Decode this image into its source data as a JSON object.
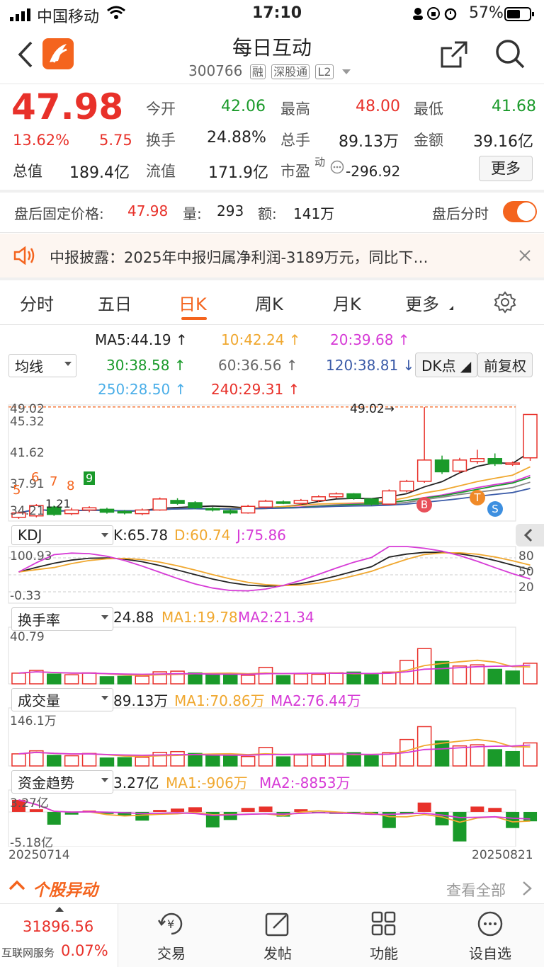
{
  "status_bar": {
    "carrier": "中国移动",
    "time": "17:10",
    "battery": "57%"
  },
  "header": {
    "title": "每日互动",
    "code": "300766",
    "badges": [
      "融",
      "深股通",
      "L2"
    ]
  },
  "quote": {
    "price": "47.98",
    "change_pct": "13.62%",
    "change": "5.75",
    "total_cap_label": "总值",
    "total_cap": "189.4亿",
    "open_label": "今开",
    "open": "42.06",
    "high_label": "最高",
    "high": "48.00",
    "low_label": "最低",
    "low": "41.68",
    "turnover_label": "换手",
    "turnover": "24.88%",
    "volume_label": "总手",
    "volume": "89.13万",
    "amount_label": "金额",
    "amount": "39.16亿",
    "float_label": "流值",
    "float_cap": "171.9亿",
    "pe_label": "市盈",
    "pe_sup": "动",
    "pe": "-296.92",
    "more": "更多"
  },
  "after_hours": {
    "price_label": "盘后固定价格:",
    "price": "47.98",
    "vol_label": "量:",
    "vol": "293",
    "amt_label": "额:",
    "amt": "141万",
    "toggle_label": "盘后分时"
  },
  "notice": {
    "text": "中报披露：2025年中报归属净利润-3189万元，同比下…"
  },
  "tabs": [
    "分时",
    "五日",
    "日K",
    "周K",
    "月K",
    "更多"
  ],
  "ma": {
    "ma5": "MA5:44.19",
    "ma10": "10:42.24",
    "ma20": "20:39.68",
    "ma30": "30:38.58",
    "ma60": "60:36.56",
    "ma120": "120:38.81",
    "ma250": "250:28.50",
    "ma240": "240:29.31",
    "selector": "均线",
    "dk": "DK点",
    "adj": "前复权"
  },
  "kline": {
    "y_top": "49.02",
    "y2": "45.32",
    "y3": "41.62",
    "y4": "37.91",
    "y5": "34.21",
    "max_label": "49.02",
    "seq_labels": [
      "5",
      "6",
      "7",
      "8",
      "9"
    ],
    "markers": [
      "B",
      "T",
      "S"
    ],
    "bar_partial": "1.21"
  },
  "kdj": {
    "selector": "KDJ",
    "k": "K:65.78",
    "d": "D:60.74",
    "j": "J:75.86",
    "top": "100.93",
    "bottom": "-0.33",
    "r80": "80",
    "r50": "50",
    "r20": "20"
  },
  "turnover_panel": {
    "selector": "换手率",
    "value": "24.88",
    "ma1": "MA1:19.78",
    "ma2": "MA2:21.34",
    "max": "40.79"
  },
  "volume_panel": {
    "selector": "成交量",
    "value": "89.13万",
    "ma1": "MA1:70.86万",
    "ma2": "MA2:76.44万",
    "max": "146.1万"
  },
  "fund_panel": {
    "selector": "资金趋势",
    "value": "3.27亿",
    "ma1": "MA1:-906万",
    "ma2": "MA2:-8853万",
    "max": "3.27亿",
    "min": "-5.18亿"
  },
  "dates": {
    "start": "20250714",
    "end": "20250821"
  },
  "movers": {
    "title": "个股异动",
    "view_all": "查看全部"
  },
  "bottom_bar": {
    "index_value": "31896.56",
    "index_label": "互联网服务",
    "index_pct": "0.07%",
    "trade": "交易",
    "post": "发帖",
    "func": "功能",
    "watch": "设自选"
  },
  "colors": {
    "red": "#e8312a",
    "green": "#1a9a2a",
    "accent": "#f4641e"
  },
  "chart_data": {
    "type": "candlestick",
    "candles": [
      {
        "o": 34.0,
        "c": 34.6,
        "h": 34.9,
        "l": 33.8
      },
      {
        "o": 34.2,
        "c": 35.6,
        "h": 35.8,
        "l": 34.0
      },
      {
        "o": 35.4,
        "c": 34.4,
        "h": 35.6,
        "l": 34.2
      },
      {
        "o": 34.5,
        "c": 35.0,
        "h": 35.3,
        "l": 34.3
      },
      {
        "o": 35.0,
        "c": 35.3,
        "h": 35.5,
        "l": 34.7
      },
      {
        "o": 35.1,
        "c": 34.7,
        "h": 35.3,
        "l": 34.5
      },
      {
        "o": 34.8,
        "c": 34.6,
        "h": 35.0,
        "l": 34.4
      },
      {
        "o": 34.5,
        "c": 35.0,
        "h": 35.2,
        "l": 34.3
      },
      {
        "o": 35.0,
        "c": 36.5,
        "h": 36.7,
        "l": 34.9
      },
      {
        "o": 36.3,
        "c": 35.9,
        "h": 36.6,
        "l": 35.7
      },
      {
        "o": 36.0,
        "c": 35.3,
        "h": 36.2,
        "l": 35.1
      },
      {
        "o": 35.2,
        "c": 35.0,
        "h": 35.4,
        "l": 34.8
      },
      {
        "o": 34.9,
        "c": 34.6,
        "h": 35.1,
        "l": 34.4
      },
      {
        "o": 34.6,
        "c": 35.5,
        "h": 35.7,
        "l": 34.5
      },
      {
        "o": 35.4,
        "c": 36.2,
        "h": 36.4,
        "l": 35.2
      },
      {
        "o": 36.1,
        "c": 36.0,
        "h": 36.3,
        "l": 35.8
      },
      {
        "o": 35.9,
        "c": 36.3,
        "h": 36.5,
        "l": 35.7
      },
      {
        "o": 36.3,
        "c": 36.8,
        "h": 37.0,
        "l": 36.1
      },
      {
        "o": 36.8,
        "c": 37.2,
        "h": 37.4,
        "l": 36.6
      },
      {
        "o": 37.2,
        "c": 36.6,
        "h": 37.3,
        "l": 36.4
      },
      {
        "o": 36.5,
        "c": 35.8,
        "h": 36.6,
        "l": 35.6
      },
      {
        "o": 35.8,
        "c": 37.6,
        "h": 37.8,
        "l": 35.7
      },
      {
        "o": 37.6,
        "c": 38.9,
        "h": 39.1,
        "l": 37.4
      },
      {
        "o": 38.9,
        "c": 41.8,
        "h": 49.0,
        "l": 38.7
      },
      {
        "o": 41.8,
        "c": 40.2,
        "h": 42.4,
        "l": 39.9
      },
      {
        "o": 40.3,
        "c": 41.8,
        "h": 42.1,
        "l": 40.0
      },
      {
        "o": 41.6,
        "c": 42.0,
        "h": 43.2,
        "l": 41.3
      },
      {
        "o": 42.0,
        "c": 41.3,
        "h": 42.7,
        "l": 41.0
      },
      {
        "o": 41.3,
        "c": 41.4,
        "h": 41.6,
        "l": 41.0
      },
      {
        "o": 42.1,
        "c": 48.0,
        "h": 48.0,
        "l": 41.7
      }
    ],
    "turnover": [
      {
        "v": 8.1,
        "up": true
      },
      {
        "v": 10.2,
        "up": true
      },
      {
        "v": 7.4,
        "up": false
      },
      {
        "v": 6.9,
        "up": true
      },
      {
        "v": 8.3,
        "up": true
      },
      {
        "v": 5.4,
        "up": false
      },
      {
        "v": 5.7,
        "up": false
      },
      {
        "v": 5.9,
        "up": true
      },
      {
        "v": 9.1,
        "up": true
      },
      {
        "v": 9.6,
        "up": true
      },
      {
        "v": 8.3,
        "up": false
      },
      {
        "v": 7.1,
        "up": false
      },
      {
        "v": 6.7,
        "up": false
      },
      {
        "v": 6.5,
        "up": true
      },
      {
        "v": 12.5,
        "up": true
      },
      {
        "v": 6.2,
        "up": false
      },
      {
        "v": 7.5,
        "up": true
      },
      {
        "v": 7.3,
        "up": true
      },
      {
        "v": 8.4,
        "up": true
      },
      {
        "v": 8.9,
        "up": false
      },
      {
        "v": 7.0,
        "up": false
      },
      {
        "v": 8.9,
        "up": true
      },
      {
        "v": 17.8,
        "up": true
      },
      {
        "v": 26.7,
        "up": true
      },
      {
        "v": 16.9,
        "up": false
      },
      {
        "v": 13.5,
        "up": true
      },
      {
        "v": 14.4,
        "up": true
      },
      {
        "v": 11.0,
        "up": false
      },
      {
        "v": 9.7,
        "up": false
      },
      {
        "v": 15.6,
        "up": true
      }
    ],
    "volume": [
      {
        "v": 32,
        "up": true
      },
      {
        "v": 40,
        "up": true
      },
      {
        "v": 28,
        "up": false
      },
      {
        "v": 27,
        "up": true
      },
      {
        "v": 33,
        "up": true
      },
      {
        "v": 21,
        "up": false
      },
      {
        "v": 22,
        "up": false
      },
      {
        "v": 23,
        "up": true
      },
      {
        "v": 36,
        "up": true
      },
      {
        "v": 38,
        "up": true
      },
      {
        "v": 33,
        "up": false
      },
      {
        "v": 28,
        "up": false
      },
      {
        "v": 26,
        "up": false
      },
      {
        "v": 25,
        "up": true
      },
      {
        "v": 49,
        "up": true
      },
      {
        "v": 24,
        "up": false
      },
      {
        "v": 29,
        "up": true
      },
      {
        "v": 28,
        "up": true
      },
      {
        "v": 33,
        "up": true
      },
      {
        "v": 35,
        "up": false
      },
      {
        "v": 27,
        "up": false
      },
      {
        "v": 35,
        "up": true
      },
      {
        "v": 70,
        "up": true
      },
      {
        "v": 104,
        "up": true
      },
      {
        "v": 66,
        "up": false
      },
      {
        "v": 53,
        "up": true
      },
      {
        "v": 56,
        "up": true
      },
      {
        "v": 43,
        "up": false
      },
      {
        "v": 38,
        "up": false
      },
      {
        "v": 61,
        "up": true
      }
    ],
    "fund": [
      1.8,
      0.4,
      -1.9,
      -0.4,
      0.2,
      -0.3,
      -0.6,
      -1.3,
      0.3,
      0.5,
      0.7,
      -2.3,
      -1.2,
      0.6,
      0.8,
      -0.7,
      0.4,
      -0.2,
      -0.3,
      -0.2,
      -0.4,
      -2.4,
      -0.3,
      1.4,
      -2.0,
      -4.4,
      0.8,
      0.6,
      -2.4,
      -1.4,
      3.27
    ]
  }
}
